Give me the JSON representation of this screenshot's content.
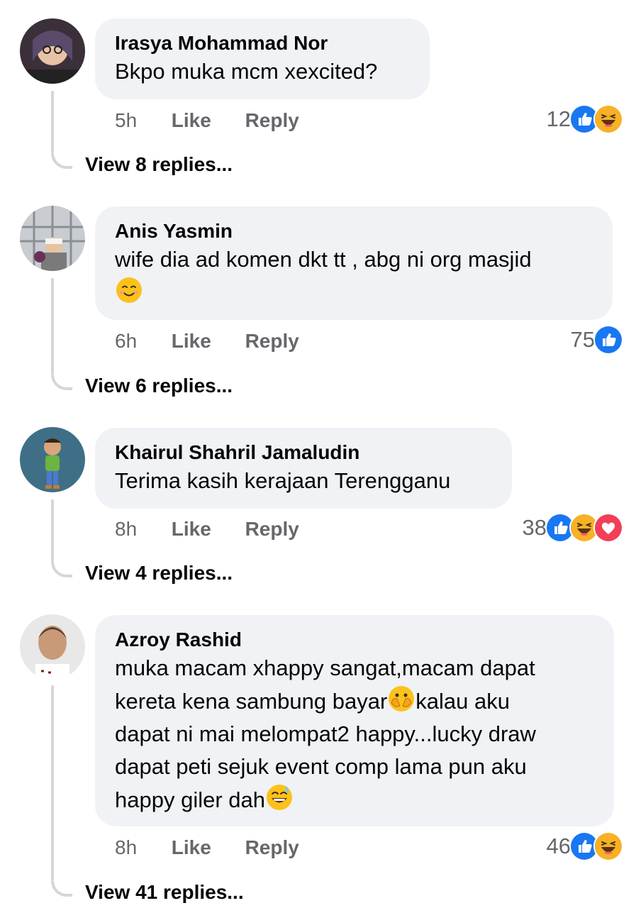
{
  "comments": [
    {
      "name": "Irasya Mohammad Nor",
      "text_lines": [
        "Bkpo muka mcm xexcited?"
      ],
      "time": "5h",
      "like_label": "Like",
      "reply_label": "Reply",
      "reaction_count": "12",
      "reactions": [
        "like-icon",
        "haha-icon"
      ],
      "view_replies": "View 8 replies..."
    },
    {
      "name": "Anis Yasmin",
      "text_lines": [
        "wife dia ad komen dkt tt , abg ni org masjid"
      ],
      "trailing_emoji": "smiling-blush-emoji",
      "time": "6h",
      "like_label": "Like",
      "reply_label": "Reply",
      "reaction_count": "75",
      "reactions": [
        "like-icon"
      ],
      "view_replies": "View 6 replies..."
    },
    {
      "name": "Khairul Shahril Jamaludin",
      "text_lines": [
        "Terima kasih kerajaan Terengganu"
      ],
      "time": "8h",
      "like_label": "Like",
      "reply_label": "Reply",
      "reaction_count": "38",
      "reactions": [
        "like-icon",
        "haha-icon",
        "love-icon"
      ],
      "view_replies": "View 4 replies..."
    },
    {
      "name": "Azroy Rashid",
      "text_lines": [
        "muka macam xhappy sangat,macam dapat",
        "kereta kena sambung bayar",
        "kalau aku",
        "dapat ni mai melompat2 happy...lucky draw",
        "dapat peti sejuk event comp lama pun aku",
        "happy giler dah"
      ],
      "time": "8h",
      "like_label": "Like",
      "reply_label": "Reply",
      "reaction_count": "46",
      "reactions": [
        "like-icon",
        "haha-icon"
      ],
      "view_replies": "View 41 replies..."
    }
  ],
  "colors": {
    "bubble": "#f0f2f5",
    "meta_text": "#65676b",
    "like_blue": "#1877f2",
    "love_red": "#f33e58",
    "haha_yellow": "#f7b125"
  }
}
